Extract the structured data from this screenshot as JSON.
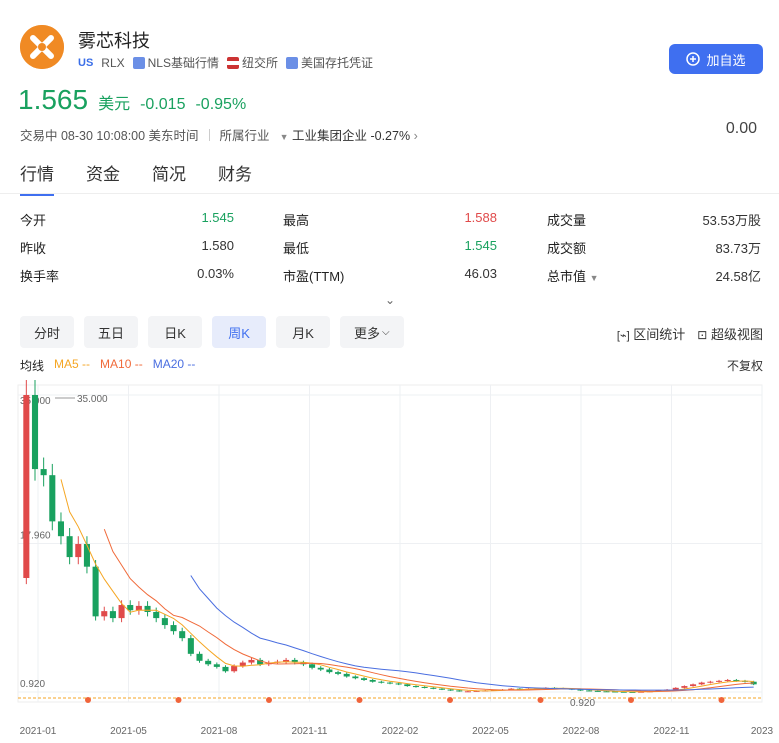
{
  "header": {
    "name": "雾芯科技",
    "market": "US",
    "ticker": "RLX",
    "tags": [
      "NLS基础行情",
      "纽交所",
      "美国存托凭证"
    ],
    "add_button": "加自选"
  },
  "quote": {
    "price": "1.565",
    "currency": "美元",
    "change": "-0.015",
    "change_pct": "-0.95%",
    "status": "交易中 08-30 10:08:00 美东时间",
    "industry_label": "所属行业",
    "industry": "工业集团企业",
    "industry_chg": "-0.27%",
    "right_value": "0.00"
  },
  "tabs": [
    "行情",
    "资金",
    "简况",
    "财务"
  ],
  "stats": [
    {
      "label": "今开",
      "value": "1.545"
    },
    {
      "label": "昨收",
      "value": "1.580"
    },
    {
      "label": "换手率",
      "value": "0.03%"
    },
    {
      "label": "最高",
      "value": "1.588"
    },
    {
      "label": "最低",
      "value": "1.545"
    },
    {
      "label": "市盈(TTM)",
      "value": "46.03"
    },
    {
      "label": "成交量",
      "value": "53.53万股"
    },
    {
      "label": "成交额",
      "value": "83.73万"
    },
    {
      "label": "总市值",
      "value": "24.58亿"
    }
  ],
  "periods": [
    "分时",
    "五日",
    "日K",
    "周K",
    "月K",
    "更多"
  ],
  "active_period": "周K",
  "tools": [
    "区间统计",
    "超级视图"
  ],
  "indicators": {
    "label": "均线",
    "ma5": "MA5 --",
    "ma10": "MA10 --",
    "ma20": "MA20 --",
    "adjust": "不复权"
  },
  "colors": {
    "up": "#e04a4a",
    "down": "#19a15f",
    "ma5": "#f5a623",
    "ma10": "#f06a3a",
    "ma20": "#4a6ee0",
    "accent": "#3f6ff0"
  },
  "chart_data": {
    "type": "candlestick",
    "y_labels": [
      "35.000",
      "17.960",
      "0.920"
    ],
    "high_marker": "35.000",
    "low_marker": "0.920",
    "x_labels": [
      "2021-01",
      "2021-05",
      "2021-08",
      "2021-11",
      "2022-02",
      "2022-05",
      "2022-08",
      "2022-11",
      "2023"
    ],
    "ylim": [
      0.92,
      35.0
    ],
    "weekly_close": [
      35.0,
      26.5,
      25.8,
      20.5,
      18.8,
      16.4,
      17.9,
      15.3,
      9.6,
      10.2,
      9.4,
      10.9,
      10.3,
      10.8,
      10.1,
      9.4,
      8.6,
      7.9,
      7.1,
      5.3,
      4.5,
      4.1,
      3.8,
      3.3,
      3.9,
      4.3,
      4.6,
      4.1,
      4.3,
      4.4,
      4.6,
      4.3,
      4.1,
      3.7,
      3.5,
      3.2,
      3.0,
      2.7,
      2.5,
      2.3,
      2.1,
      2.0,
      1.9,
      1.8,
      1.6,
      1.5,
      1.4,
      1.3,
      1.2,
      1.1,
      1.0,
      1.0,
      1.05,
      1.1,
      1.15,
      1.2,
      1.3,
      1.25,
      1.3,
      1.35,
      1.4,
      1.35,
      1.3,
      1.2,
      1.1,
      1.05,
      1.0,
      0.98,
      0.95,
      0.93,
      0.92,
      0.95,
      1.0,
      1.1,
      1.2,
      1.4,
      1.6,
      1.8,
      2.0,
      2.1,
      2.2,
      2.3,
      2.2,
      2.1,
      1.8
    ]
  }
}
